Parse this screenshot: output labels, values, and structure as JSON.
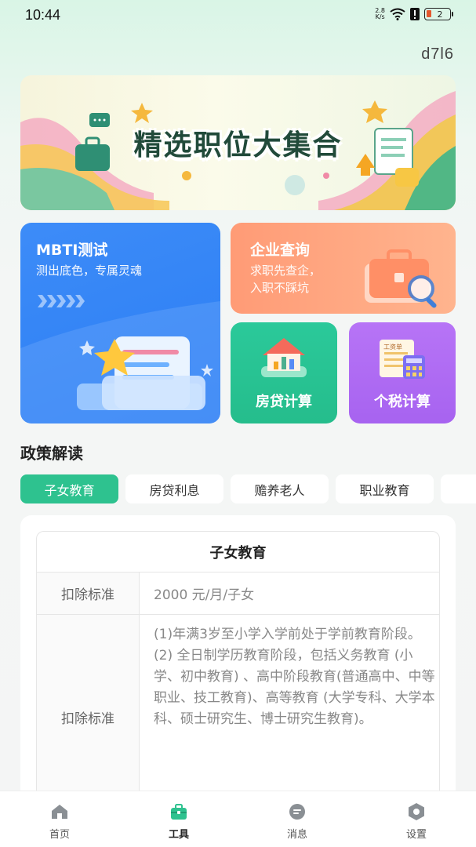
{
  "status_bar": {
    "time": "10:44",
    "net_speed_top": "2.8",
    "net_speed_bottom": "K/s",
    "battery": "2"
  },
  "app_code": "d7l6",
  "banner": {
    "title": "精选职位大集合"
  },
  "cards": {
    "mbti": {
      "title": "MBTI测试",
      "subtitle": "测出底色，专属灵魂",
      "arrows": "›››››"
    },
    "company": {
      "title": "企业查询",
      "subtitle_line1": "求职先查企，",
      "subtitle_line2": "入职不踩坑"
    },
    "mortgage": {
      "label": "房贷计算"
    },
    "tax": {
      "label": "个税计算",
      "icon_text": "工资单"
    }
  },
  "policy": {
    "section_title": "政策解读",
    "tabs": [
      {
        "label": "子女教育",
        "active": true
      },
      {
        "label": "房贷利息"
      },
      {
        "label": "赡养老人"
      },
      {
        "label": "职业教育"
      }
    ],
    "table": {
      "header": "子女教育",
      "rows": [
        {
          "label": "扣除标准",
          "value": "2000 元/月/子女"
        },
        {
          "label": "扣除标准",
          "value": "(1)年满3岁至小学入学前处于学前教育阶段。\n(2) 全日制学历教育阶段，包括义务教育 (小学、初中教育) 、高中阶段教育(普通高中、中等职业、技工教育)、高等教育 (大学专科、大学本科、硕士研究生、博士研究生教育)。"
        }
      ]
    }
  },
  "tabbar": {
    "items": [
      {
        "label": "首页",
        "icon": "home-icon"
      },
      {
        "label": "工具",
        "icon": "toolbox-icon",
        "active": true
      },
      {
        "label": "消息",
        "icon": "message-icon"
      },
      {
        "label": "设置",
        "icon": "settings-icon"
      }
    ]
  },
  "colors": {
    "accent": "#2ec28f",
    "mbti": "#2b7df3",
    "company": "#ff9b76",
    "mortgage": "#25bd8c",
    "tax": "#a763f0"
  }
}
